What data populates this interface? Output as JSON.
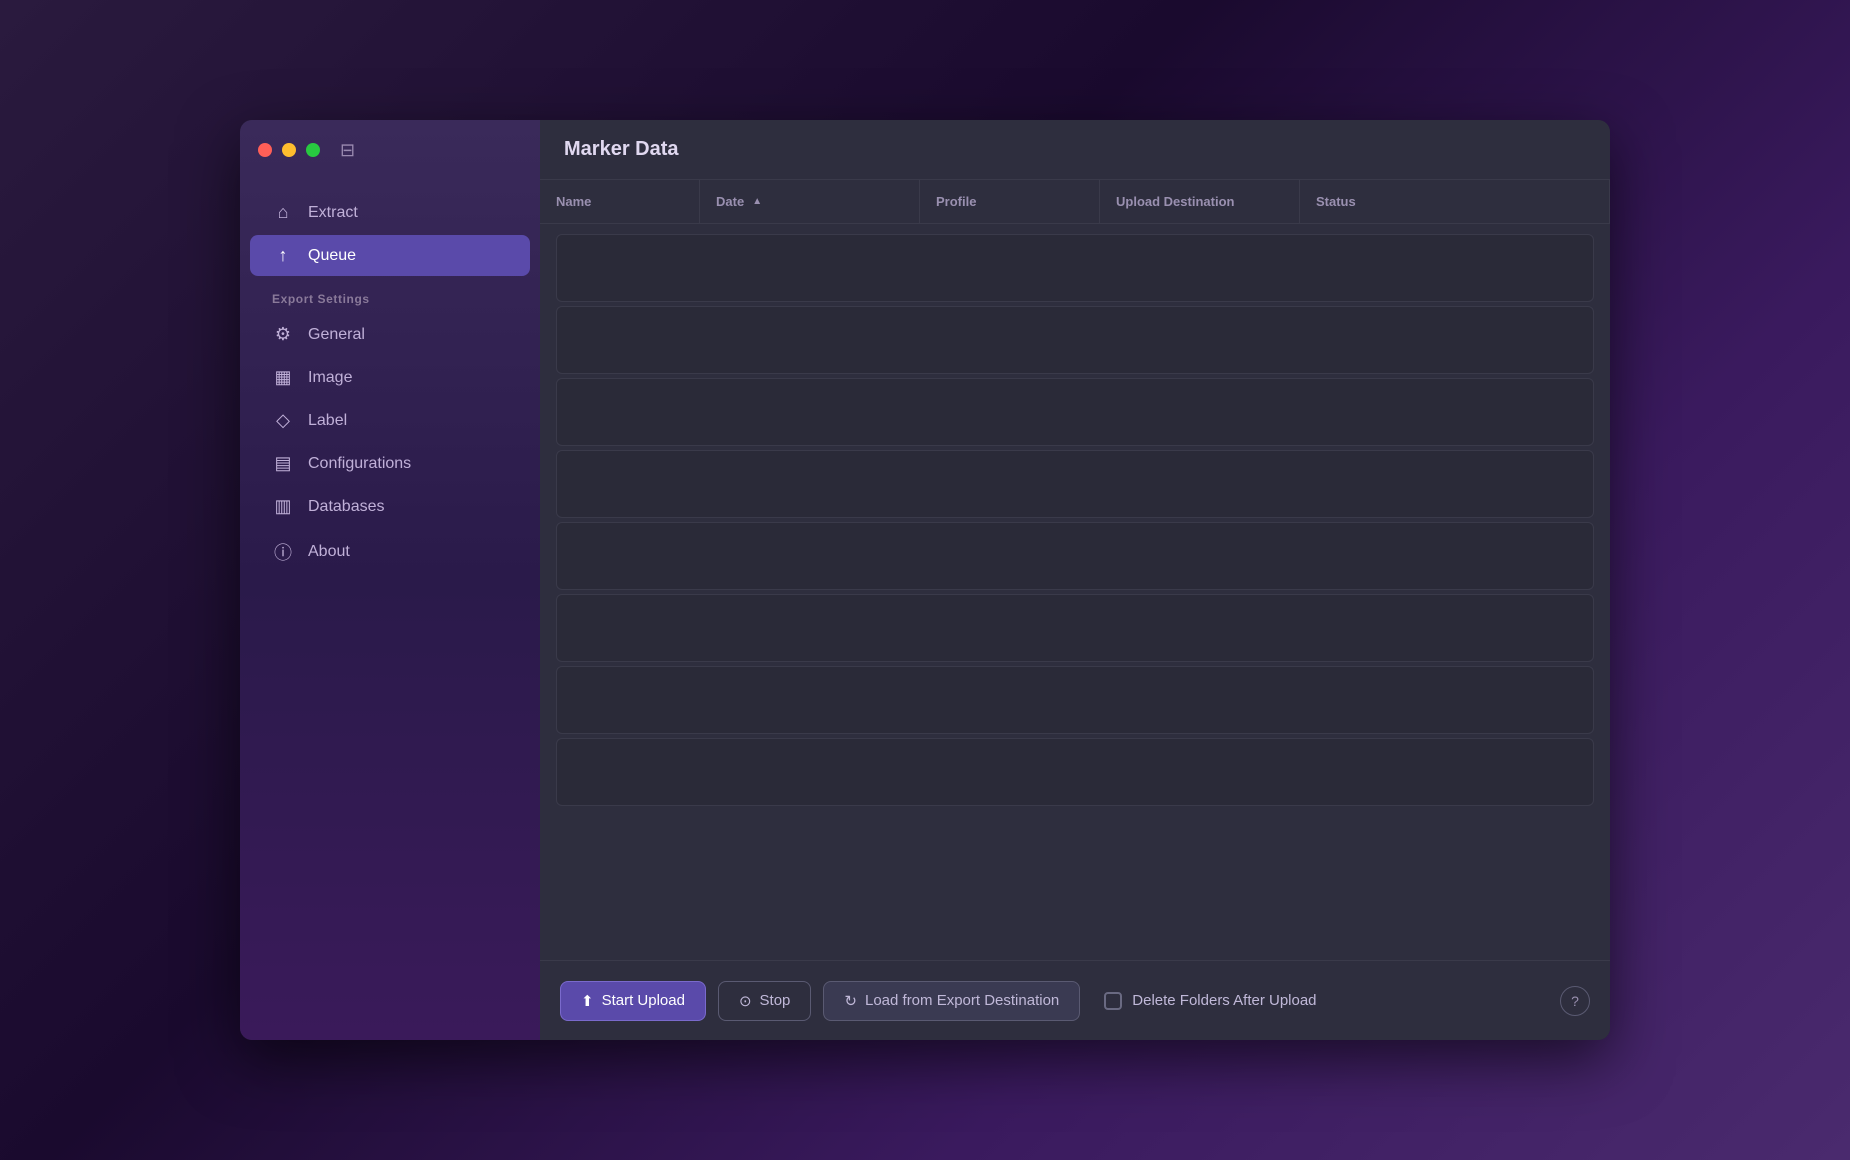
{
  "window": {
    "title": "Marker Data"
  },
  "titlebar": {
    "toggle_icon": "⊞"
  },
  "sidebar": {
    "nav_main": [
      {
        "id": "extract",
        "label": "Extract",
        "icon": "⌂",
        "active": false
      },
      {
        "id": "queue",
        "label": "Queue",
        "icon": "↑",
        "active": true
      }
    ],
    "section_label": "Export Settings",
    "nav_settings": [
      {
        "id": "general",
        "label": "General",
        "icon": "⚙"
      },
      {
        "id": "image",
        "label": "Image",
        "icon": "▦"
      },
      {
        "id": "label",
        "label": "Label",
        "icon": "◇"
      },
      {
        "id": "configurations",
        "label": "Configurations",
        "icon": "▤"
      },
      {
        "id": "databases",
        "label": "Databases",
        "icon": "▥"
      },
      {
        "id": "about",
        "label": "About",
        "icon": "ⓘ"
      }
    ]
  },
  "table": {
    "columns": [
      {
        "id": "name",
        "label": "Name"
      },
      {
        "id": "date",
        "label": "Date",
        "sortable": true
      },
      {
        "id": "profile",
        "label": "Profile"
      },
      {
        "id": "upload-destination",
        "label": "Upload Destination"
      },
      {
        "id": "status",
        "label": "Status"
      }
    ],
    "rows": [
      {},
      {},
      {},
      {},
      {},
      {},
      {},
      {}
    ]
  },
  "toolbar": {
    "start_upload_label": "Start Upload",
    "stop_label": "Stop",
    "load_from_export_label": "Load from Export Destination",
    "delete_folders_label": "Delete Folders After Upload",
    "help_icon": "?"
  },
  "colors": {
    "active_nav": "#5a4aaa",
    "accent": "#5a4aaa"
  }
}
